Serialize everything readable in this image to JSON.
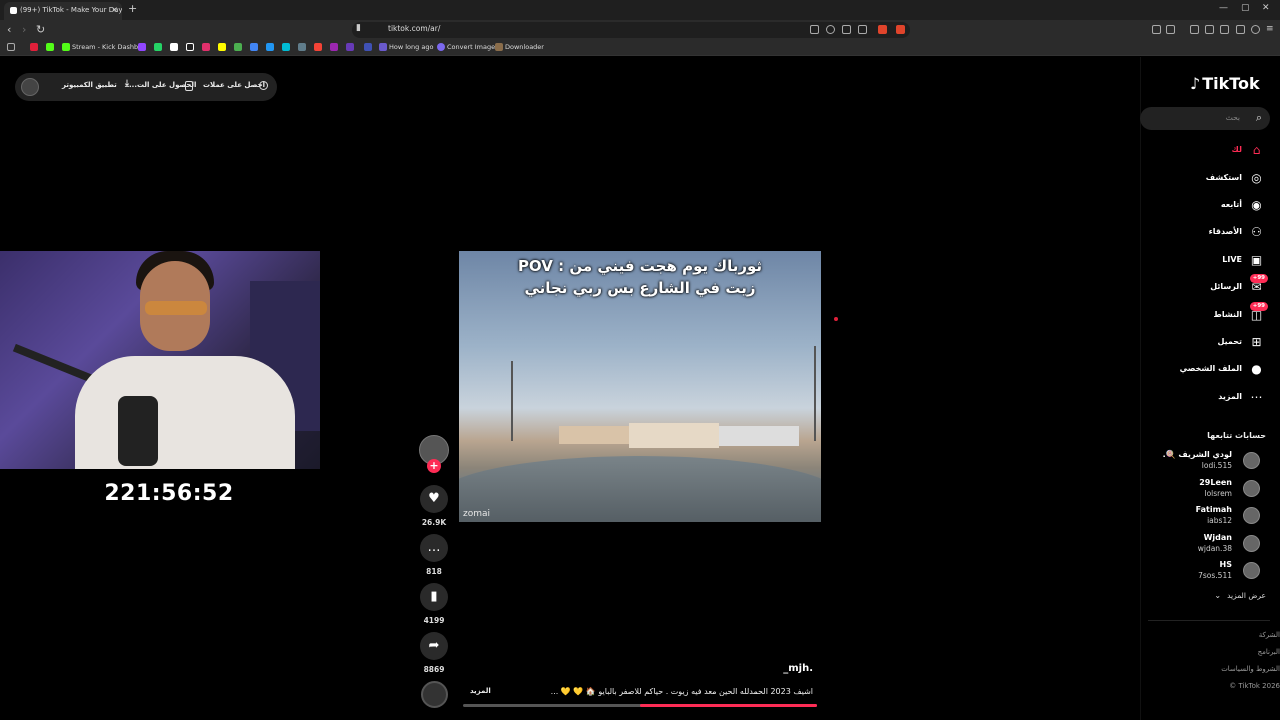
{
  "browser": {
    "tab_title": "(99+) TikTok - Make Your Day",
    "tab_close": "×",
    "new_tab": "+",
    "url": "tiktok.com/ar/",
    "window_controls": [
      "—",
      "▢",
      "✕"
    ],
    "bookmarks": [
      {
        "label": "Stream - Kick Dashb...",
        "color": "#53fc18"
      },
      {
        "label": "How long ago",
        "color": "#6a5acd"
      },
      {
        "label": "Convert Image",
        "color": "#7b68ee"
      },
      {
        "label": "Downloader",
        "color": "#8a6d4b"
      }
    ]
  },
  "top_pill": {
    "get_coins": "احصل على عملات",
    "get_app": "الحصول على الت...",
    "pc_app": "تطبيق الكمبيوتر"
  },
  "stream_overlay": {
    "timer": "221:56:52"
  },
  "video": {
    "caption_line1": "ثورباك يوم هجت فيني من : POV",
    "caption_line2": "زيت في الشارع بس ربي نجاني",
    "watermark": "zomai",
    "author": "_mjh.",
    "description": "اشيف 2023 الحمدلله الحين معد فيه زيوت . حياكم للاصفر بالبايو 🏠 💛 💛 ...",
    "more_label": "المزيد",
    "progress": 0.5
  },
  "actions": {
    "follow_plus": "+",
    "likes": "26.9K",
    "comments": "818",
    "saves": "4199",
    "shares": "8869"
  },
  "sidebar": {
    "logo": "TikTok",
    "search_placeholder": "بحث",
    "nav": [
      {
        "label": "لك",
        "icon": "home-icon",
        "active": true
      },
      {
        "label": "استكشف",
        "icon": "compass-icon"
      },
      {
        "label": "أتابعه",
        "icon": "following-icon"
      },
      {
        "label": "الأصدقاء",
        "icon": "friends-icon"
      },
      {
        "label": "LIVE",
        "icon": "live-icon"
      },
      {
        "label": "الرسائل",
        "icon": "messages-icon",
        "badge": "+99"
      },
      {
        "label": "النشاط",
        "icon": "activity-icon",
        "badge": "+99"
      },
      {
        "label": "تحميل",
        "icon": "upload-icon"
      },
      {
        "label": "الملف الشخصي",
        "icon": "profile-icon"
      },
      {
        "label": "المزيد",
        "icon": "more-icon"
      }
    ],
    "following_title": "حسابات تتابعها",
    "following": [
      {
        "name": "لودي الشريف 🍭.",
        "username": "lodi.515"
      },
      {
        "name": "29Leen",
        "username": "lolsrem"
      },
      {
        "name": "Fatimah",
        "username": "iabs12"
      },
      {
        "name": "Wjdan",
        "username": "wjdan.38"
      },
      {
        "name": "HS",
        "username": "7sos.511"
      }
    ],
    "see_more": "عرض المزيد",
    "footer": [
      "الشركة",
      "البرنامج",
      "الشروط والسياسات",
      "TikTok 2026 ©"
    ]
  },
  "colors": {
    "accent": "#fe2c55",
    "background": "#000000"
  }
}
